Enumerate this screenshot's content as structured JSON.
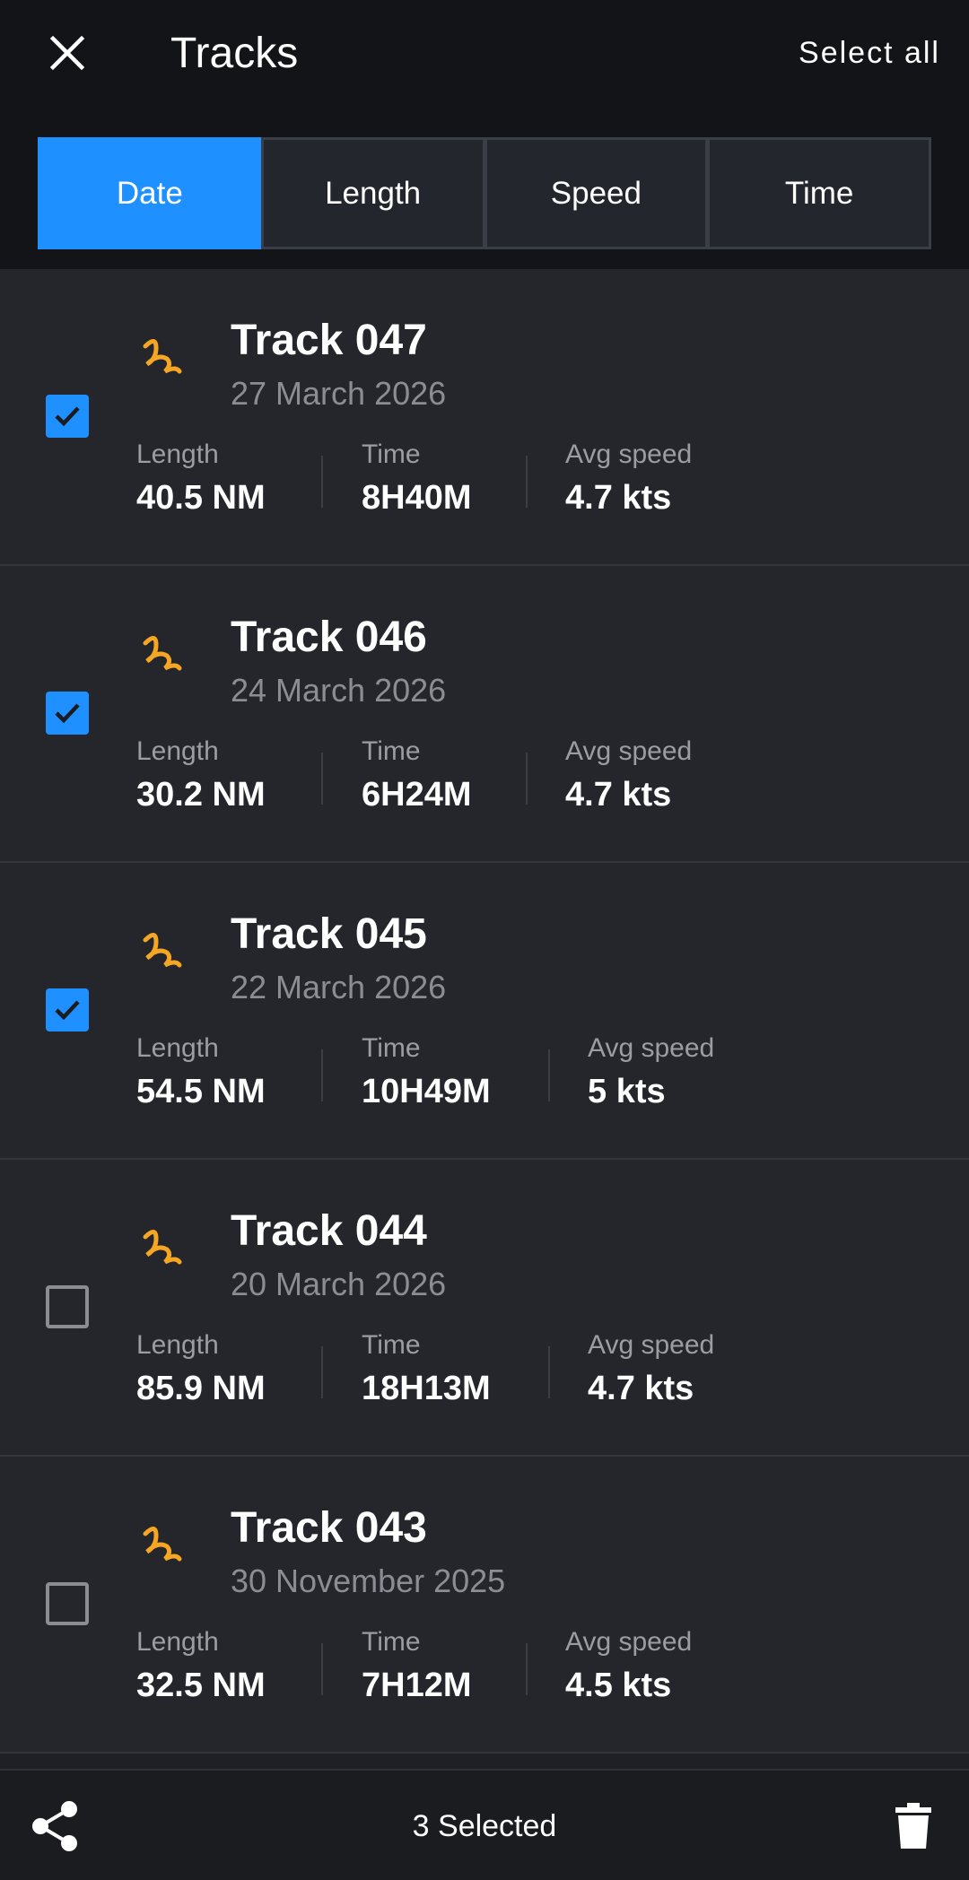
{
  "header": {
    "title": "Tracks",
    "select_all_label": "Select all",
    "close_icon": "close-icon"
  },
  "sort_tabs": [
    {
      "label": "Date",
      "active": true
    },
    {
      "label": "Length",
      "active": false
    },
    {
      "label": "Speed",
      "active": false
    },
    {
      "label": "Time",
      "active": false
    }
  ],
  "stat_labels": {
    "length": "Length",
    "time": "Time",
    "avg_speed": "Avg speed"
  },
  "tracks": [
    {
      "name": "Track 047",
      "date": "27 March 2026",
      "length": "40.5 NM",
      "time": "8H40M",
      "avg_speed": "4.7 kts",
      "checked": true
    },
    {
      "name": "Track 046",
      "date": "24 March 2026",
      "length": "30.2 NM",
      "time": "6H24M",
      "avg_speed": "4.7 kts",
      "checked": true
    },
    {
      "name": "Track 045",
      "date": "22 March 2026",
      "length": "54.5 NM",
      "time": "10H49M",
      "avg_speed": "5 kts",
      "checked": true
    },
    {
      "name": "Track 044",
      "date": "20 March 2026",
      "length": "85.9 NM",
      "time": "18H13M",
      "avg_speed": "4.7 kts",
      "checked": false
    },
    {
      "name": "Track 043",
      "date": "30 November 2025",
      "length": "32.5 NM",
      "time": "7H12M",
      "avg_speed": "4.5 kts",
      "checked": false
    }
  ],
  "bottom_bar": {
    "selected_text": "3 Selected",
    "share_icon": "share-icon",
    "delete_icon": "trash-icon"
  },
  "colors": {
    "accent": "#1e90ff",
    "track_icon": "#f5a623",
    "background": "#1e2025",
    "header_bg": "#121418",
    "muted_text": "#8a8d93"
  }
}
